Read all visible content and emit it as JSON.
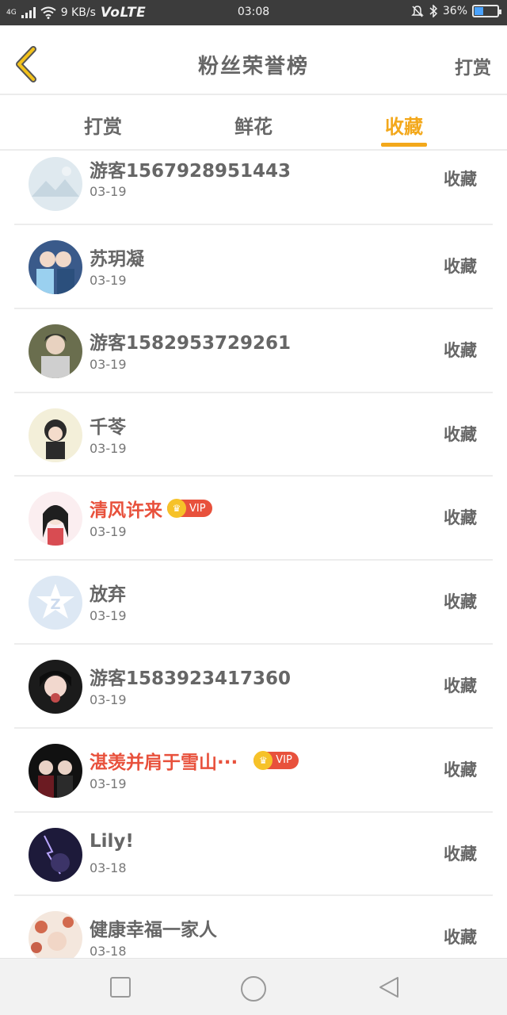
{
  "status_bar": {
    "network": "4G",
    "speed": "9 KB/s",
    "volte": "VoLTE",
    "time": "03:08",
    "battery": "36%",
    "battery_level": 0.36
  },
  "header": {
    "title": "粉丝荣誉榜",
    "action": "打赏"
  },
  "tabs": [
    {
      "label": "打赏",
      "active": false
    },
    {
      "label": "鲜花",
      "active": false
    },
    {
      "label": "收藏",
      "active": true
    }
  ],
  "accent_color": "#f3a81b",
  "vip_color": "#e8513c",
  "list": [
    {
      "name": "游客1567928951443",
      "date": "03-19",
      "action": "收藏",
      "vip": false
    },
    {
      "name": "苏玥凝",
      "date": "03-19",
      "action": "收藏",
      "vip": false
    },
    {
      "name": "游客1582953729261",
      "date": "03-19",
      "action": "收藏",
      "vip": false
    },
    {
      "name": "千苓",
      "date": "03-19",
      "action": "收藏",
      "vip": false
    },
    {
      "name": "清风许来",
      "date": "03-19",
      "action": "收藏",
      "vip": true
    },
    {
      "name": "放弃",
      "date": "03-19",
      "action": "收藏",
      "vip": false
    },
    {
      "name": "游客1583923417360",
      "date": "03-19",
      "action": "收藏",
      "vip": false
    },
    {
      "name": "湛羡并肩于雪山···",
      "date": "03-19",
      "action": "收藏",
      "vip": true
    },
    {
      "name": "Lily!",
      "date": "03-18",
      "action": "收藏",
      "vip": false
    },
    {
      "name": "健康幸福一家人",
      "date": "03-18",
      "action": "收藏",
      "vip": false
    }
  ],
  "vip_label": "VIP",
  "nav": {
    "square": "recent-apps",
    "circle": "home",
    "triangle": "back"
  }
}
